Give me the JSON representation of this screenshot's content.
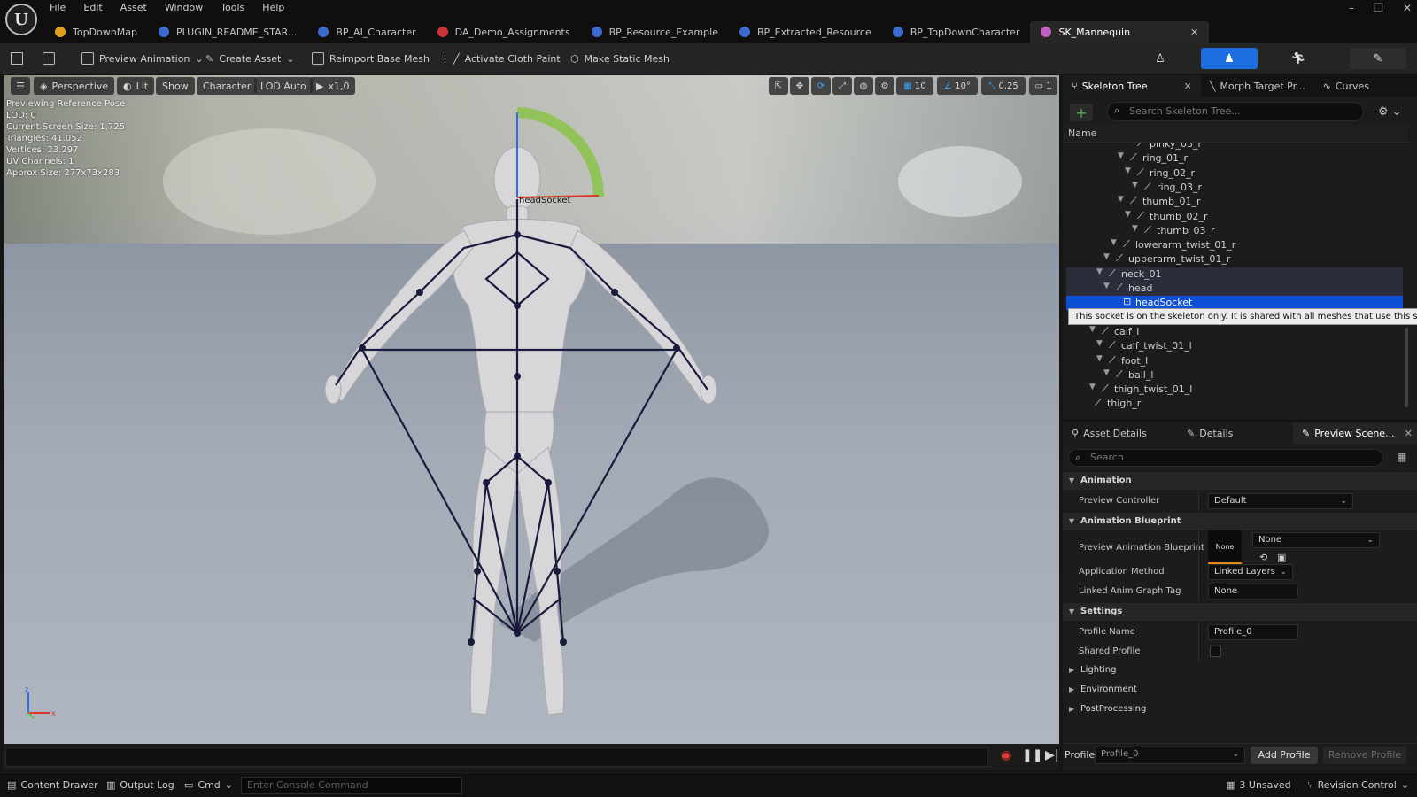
{
  "menu": [
    "File",
    "Edit",
    "Asset",
    "Window",
    "Tools",
    "Help"
  ],
  "tabs": [
    {
      "label": "TopDownMap",
      "color": "#e0a020"
    },
    {
      "label": "PLUGIN_README_STAR...",
      "color": "#3a6ad0"
    },
    {
      "label": "BP_AI_Character",
      "color": "#3a6ad0"
    },
    {
      "label": "DA_Demo_Assignments",
      "color": "#c8343a"
    },
    {
      "label": "BP_Resource_Example",
      "color": "#3a6ad0"
    },
    {
      "label": "BP_Extracted_Resource",
      "color": "#3a6ad0"
    },
    {
      "label": "BP_TopDownCharacter",
      "color": "#3a6ad0"
    },
    {
      "label": "SK_Mannequin",
      "color": "#c060c0",
      "active": true
    }
  ],
  "toolbar": {
    "preview_animation": "Preview Animation",
    "create_asset": "Create Asset",
    "reimport": "Reimport Base Mesh",
    "cloth_paint": "Activate Cloth Paint",
    "make_static": "Make Static Mesh"
  },
  "viewport": {
    "perspective": "Perspective",
    "lit": "Lit",
    "show": "Show",
    "character": "Character",
    "lod": "LOD Auto",
    "speed": "x1,0",
    "grid_snap": "10",
    "rot_snap": "10°",
    "scale_snap": "0,25",
    "camera_speed": "1",
    "info": [
      "Previewing Reference Pose",
      "LOD: 0",
      "Current Screen Size: 1,725",
      "Triangles: 41.052",
      "Vertices: 23.297",
      "UV Channels: 1",
      "Approx Size: 277x73x283"
    ],
    "socket_label": "headSocket"
  },
  "skeleton_panel": {
    "tabs": [
      "Skeleton Tree",
      "Morph Target Pr...",
      "Curves"
    ],
    "search_placeholder": "Search Skeleton Tree...",
    "column_header": "Name",
    "tooltip": "This socket is on the skeleton only. It is shared with all meshes that use this skeleton",
    "rows": [
      {
        "label": "pinky_03_r",
        "indent": 5
      },
      {
        "label": "ring_01_r",
        "indent": 4
      },
      {
        "label": "ring_02_r",
        "indent": 5
      },
      {
        "label": "ring_03_r",
        "indent": 6
      },
      {
        "label": "thumb_01_r",
        "indent": 4
      },
      {
        "label": "thumb_02_r",
        "indent": 5
      },
      {
        "label": "thumb_03_r",
        "indent": 6
      },
      {
        "label": "lowerarm_twist_01_r",
        "indent": 3
      },
      {
        "label": "upperarm_twist_01_r",
        "indent": 2
      },
      {
        "label": "neck_01",
        "indent": 1
      },
      {
        "label": "head",
        "indent": 2
      },
      {
        "label": "headSocket",
        "indent": 3
      },
      {
        "label": "",
        "indent": 0
      },
      {
        "label": "calf_l",
        "indent": 0
      },
      {
        "label": "calf_twist_01_l",
        "indent": 1
      },
      {
        "label": "foot_l",
        "indent": 1
      },
      {
        "label": "ball_l",
        "indent": 2
      },
      {
        "label": "thigh_twist_01_l",
        "indent": 0
      },
      {
        "label": "thigh_r",
        "indent": -1
      }
    ]
  },
  "details_panel": {
    "tabs": [
      "Asset Details",
      "Details",
      "Preview Scene..."
    ],
    "search_placeholder": "Search",
    "sections": {
      "animation": "Animation",
      "animation_blueprint": "Animation Blueprint",
      "settings": "Settings",
      "lighting": "Lighting",
      "environment": "Environment",
      "postprocessing": "PostProcessing"
    },
    "props": {
      "preview_controller_label": "Preview Controller",
      "preview_controller_value": "Default",
      "preview_bp_label": "Preview Animation Blueprint",
      "preview_bp_thumb": "None",
      "preview_bp_value": "None",
      "app_method_label": "Application Method",
      "app_method_value": "Linked Layers",
      "linked_tag_label": "Linked Anim Graph Tag",
      "linked_tag_value": "None",
      "profile_name_label": "Profile Name",
      "profile_name_value": "Profile_0",
      "shared_profile_label": "Shared Profile"
    },
    "profile_label": "Profile",
    "profile_value": "Profile_0",
    "add_profile": "Add Profile",
    "remove_profile": "Remove Profile"
  },
  "statusbar": {
    "content_drawer": "Content Drawer",
    "output_log": "Output Log",
    "cmd": "Cmd",
    "console_placeholder": "Enter Console Command",
    "unsaved": "3 Unsaved",
    "revision": "Revision Control"
  }
}
